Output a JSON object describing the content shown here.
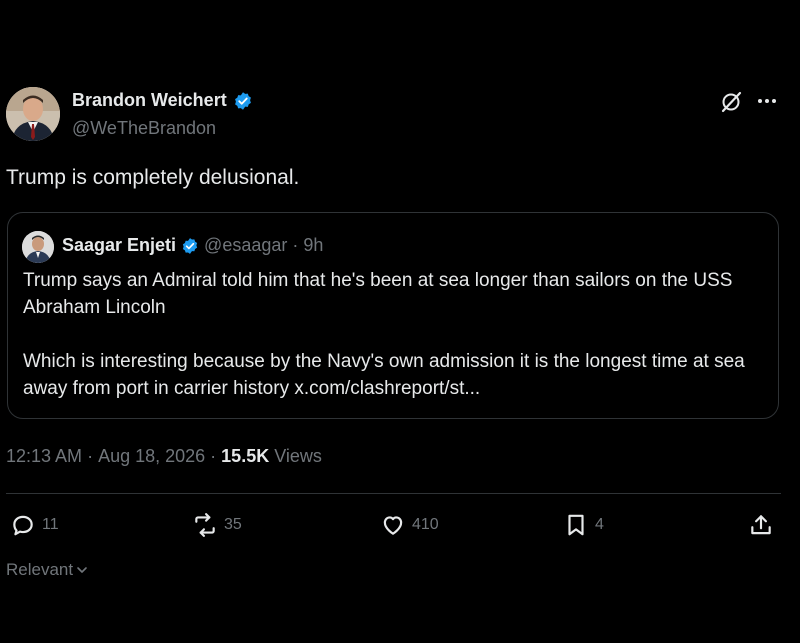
{
  "author": {
    "display_name": "Brandon Weichert",
    "handle": "@WeTheBrandon"
  },
  "tweet": {
    "text": "Trump is completely delusional."
  },
  "quoted": {
    "display_name": "Saagar Enjeti",
    "handle": "@esaagar",
    "separator": "·",
    "time": "9h",
    "paragraph1": "Trump says an Admiral told him that he's been at sea longer than sailors on the USS Abraham Lincoln",
    "paragraph2": "Which is interesting because by the Navy's own admission it is the longest time at sea away from port in carrier history x.com/clashreport/st..."
  },
  "meta": {
    "time": "12:13 AM",
    "sep1": "·",
    "date": "Aug 18, 2026",
    "sep2": "·",
    "views_count": "15.5K",
    "views_label": "Views"
  },
  "actions": {
    "replies": "11",
    "reposts": "35",
    "likes": "410",
    "bookmarks": "4"
  },
  "sort": {
    "label": "Relevant"
  },
  "colors": {
    "background": "#000000",
    "text_primary": "#e7e9ea",
    "text_secondary": "#71767b",
    "border": "#2f3336",
    "verified_blue": "#1d9bf0"
  },
  "icons": [
    "verified-badge-icon",
    "grok-icon",
    "more-icon",
    "reply-icon",
    "repost-icon",
    "like-icon",
    "bookmark-icon",
    "share-icon",
    "chevron-down-icon"
  ]
}
